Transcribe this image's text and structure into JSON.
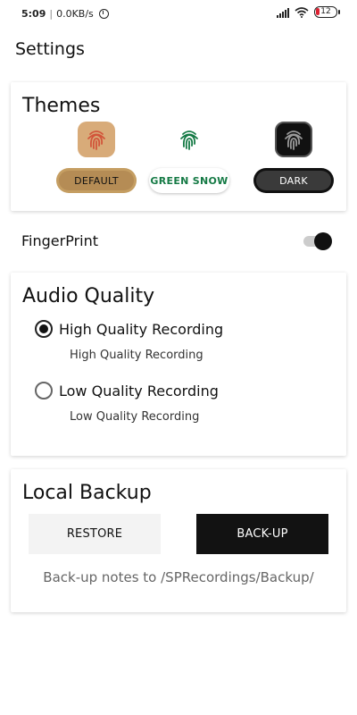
{
  "status_bar": {
    "time": "5:09",
    "network_speed": "0.0KB/s",
    "battery_level": "12"
  },
  "header": {
    "title": "Settings"
  },
  "themes": {
    "title": "Themes",
    "options": [
      {
        "label": "DEFAULT",
        "icon": "fingerprint-icon",
        "color": "#c59e62"
      },
      {
        "label": "GREEN SNOW",
        "icon": "fingerprint-icon",
        "color": "#157a45"
      },
      {
        "label": "DARK",
        "icon": "fingerprint-icon",
        "color": "#111111"
      }
    ]
  },
  "fingerprint": {
    "label": "FingerPrint",
    "enabled": true
  },
  "audio": {
    "title": "Audio Quality",
    "options": [
      {
        "label": "High Quality Recording",
        "sublabel": "High Quality Recording",
        "selected": true
      },
      {
        "label": "Low Quality Recording",
        "sublabel": "Low Quality Recording",
        "selected": false
      }
    ]
  },
  "backup": {
    "title": "Local Backup",
    "restore_label": "RESTORE",
    "backup_label": "BACK-UP",
    "note": "Back-up notes to /SPRecordings/Backup/"
  }
}
